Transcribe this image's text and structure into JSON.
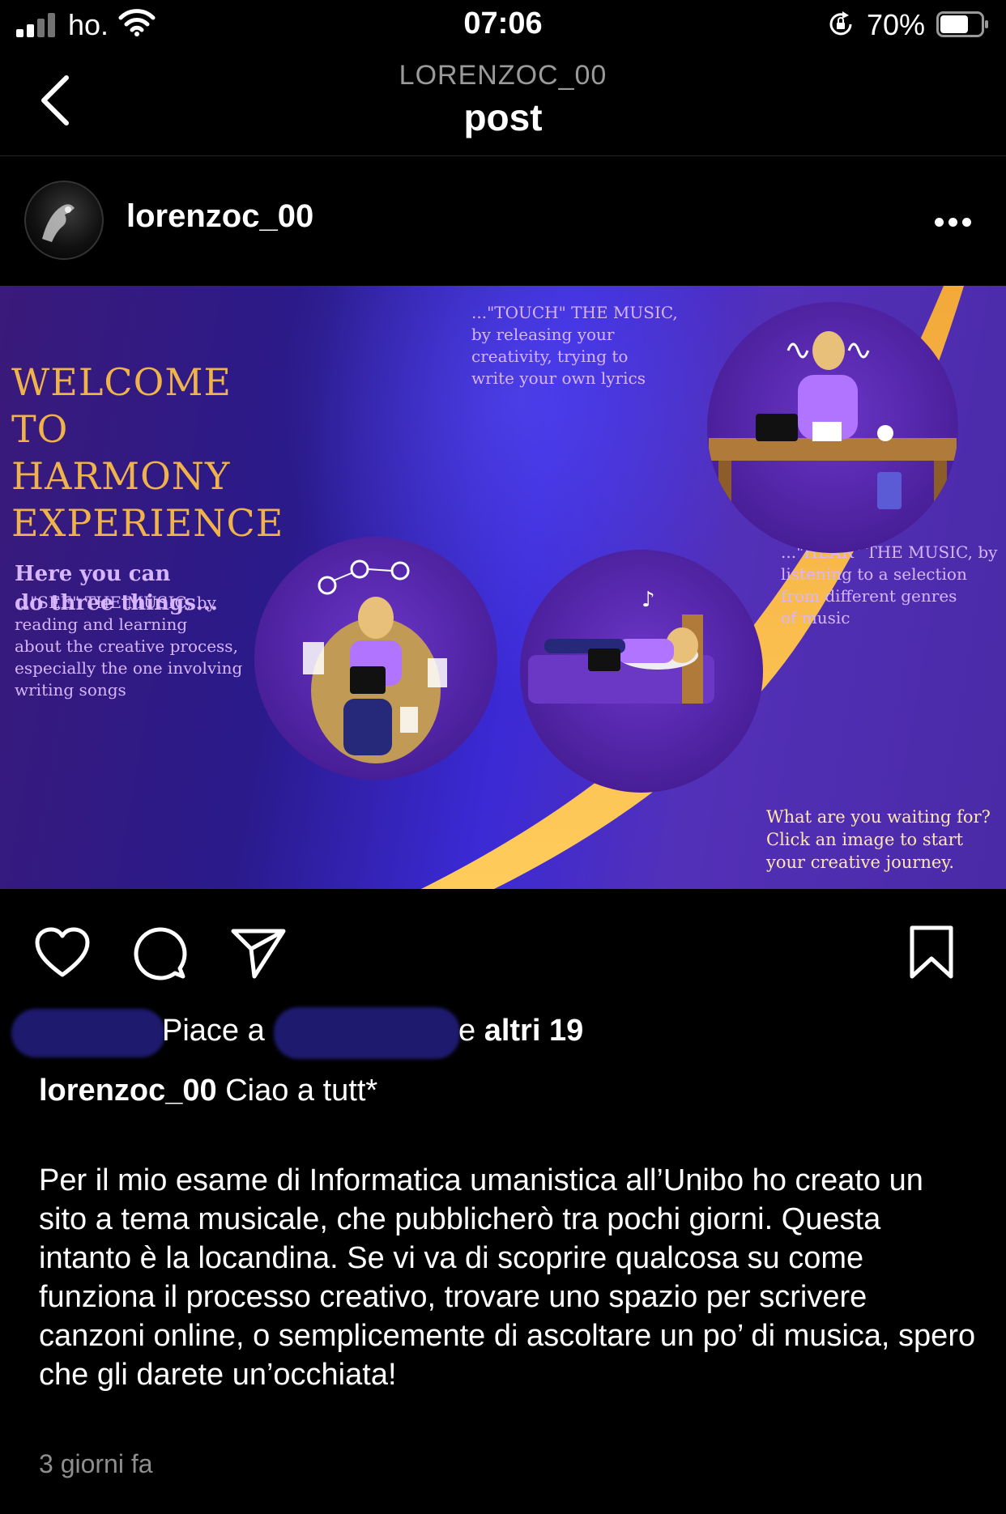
{
  "status_bar": {
    "carrier": "ho.",
    "time": "07:06",
    "battery_percent": "70%",
    "battery_level": 0.7,
    "icons": [
      "signal-icon",
      "wifi-icon",
      "orientation-lock-icon",
      "battery-icon"
    ]
  },
  "nav": {
    "subtitle": "LORENZOC_00",
    "title": "post",
    "back_icon": "chevron-left-icon"
  },
  "post": {
    "username": "lorenzoc_00",
    "more_icon": "more-horizontal-icon",
    "poster": {
      "title_lines": [
        "WELCOME",
        "TO",
        "HARMONY",
        "EXPERIENCE"
      ],
      "lead_lines": [
        "Here you can",
        "do three things..."
      ],
      "touch_lines": [
        "...\"TOUCH\" THE MUSIC,",
        "by releasing your",
        "creativity, trying to",
        "write your own lyrics"
      ],
      "see_lines": [
        "...\"SEE\" THE MUSIC, by",
        "reading and learning",
        "about the creative process,",
        "especially the one involving",
        "writing songs"
      ],
      "hear_lines": [
        "...\"HEAR\" THE MUSIC, by",
        "listening to a selection",
        "from different genres",
        "of music"
      ],
      "cta_lines": [
        "What are you waiting for?",
        "Click an image to start",
        "your creative journey."
      ],
      "colors": {
        "gold": "#f0b24a",
        "lavender": "#d7b5ff",
        "purple": "#4a1f9a"
      }
    },
    "actions": {
      "like_icon": "heart-icon",
      "comment_icon": "comment-icon",
      "share_icon": "send-icon",
      "save_icon": "bookmark-icon"
    },
    "likes": {
      "prefix": "Piace a",
      "connector": "e",
      "others": "altri 19"
    },
    "caption": {
      "username": "lorenzoc_00",
      "greeting": "Ciao a tutt*",
      "body": "Per il mio esame di Informatica umanistica all’Unibo ho creato un sito a tema musicale, che pubblicherò tra pochi giorni. Questa intanto è la locandina. Se vi va di scoprire qualcosa su come funziona il processo creativo, trovare uno spazio per scrivere canzoni online, o semplicemente di ascoltare un po’ di musica, spero che gli darete un’occhiata!"
    },
    "timestamp": "3 giorni fa"
  }
}
